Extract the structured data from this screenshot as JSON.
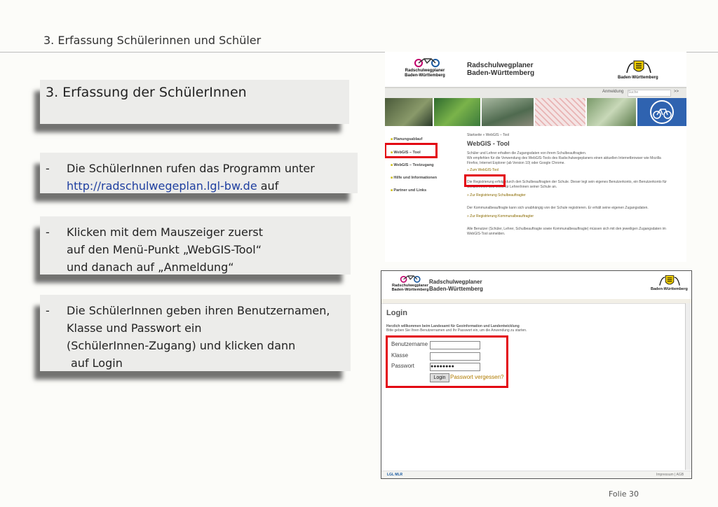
{
  "slide": {
    "header": "3. Erfassung Schülerinnen und Schüler",
    "folio": "Folie 30"
  },
  "boxes": {
    "title": "3. Erfassung der SchülerInnen",
    "dash": "-",
    "b1_line1": "Die SchülerInnen rufen das Programm unter",
    "b1_link": "http://radschulwegeplan.lgl-bw.de",
    "b1_after": "auf",
    "b2_line1": "Klicken mit dem Mauszeiger zuerst",
    "b2_line2": "auf den Menü-Punkt „WebGIS-Tool“",
    "b2_line3": "und danach auf „Anmeldung“",
    "b3_line1": "Die SchülerInnen geben ihren Benutzernamen,",
    "b3_line2": "Klasse und Passwort ein",
    "b3_line3": "(SchülerInnen-Zugang) und klicken dann",
    "b3_line4": "auf Login"
  },
  "shot1": {
    "logo_text_1": "Radschulwegplaner",
    "logo_text_2": "Baden-Württemberg",
    "site_title_1": "Radschulwegplaner",
    "site_title_2": "Baden-Württemberg",
    "state_name": "Baden-Württemberg",
    "anmeldung": "Anmeldung",
    "search_placeholder": "Suche",
    "go": ">>",
    "nav": [
      "Planungsablauf",
      "WebGIS – Tool",
      "WebGIS – Testzugang",
      "Hilfe und Informationen",
      "Partner und Links"
    ],
    "breadcrumb": "Startseite » WebGIS – Tool",
    "heading": "WebGIS - Tool",
    "p1": "Schüler und Lehrer erhalten die Zugangsdaten von ihrem Schulbeauftragten.",
    "p1b": "Wir empfehlen für die Verwendung des WebGIS-Tools des Radschulwegeplaners einen aktuellen Internetbrowser wie Mozilla",
    "p1c": "Firefox, Internet Explorer (ab Version 10) oder Google Chrome.",
    "link_tool": "» Zum WebGIS-Tool",
    "p2": "Die Registrierung erfolgt durch den Schulbeauftragten der Schule. Dieser legt sein eigenes Benutzerkonto, ein Benutzerkonto für",
    "p2b": "SchülerInnen und eines für LehrerInnen seiner Schule an.",
    "link_reg_school": "» Zur Registrierung Schulbeauftragter",
    "p3": "Der Kommunalbeauftragte kann sich unabhängig von der Schule registrieren. Er erhält seine eigenen Zugangsdaten.",
    "link_reg_comm": "» Zur Registrierung Kommunalbeauftragter",
    "p4": "Alle Benutzer (Schüler, Lehrer, Schulbeauftragte sowie Kommunalbeauftragte) müssen sich mit den jeweiligen Zugangsdaten im",
    "p4b": "WebGIS-Tool anmelden."
  },
  "shot2": {
    "logo_text_1": "Radschulwegplaner",
    "logo_text_2": "Baden-Württemberg",
    "site_title_1": "Radschulwegplaner",
    "site_title_2": "Baden-Württemberg",
    "state_name": "Baden-Württemberg",
    "login_heading": "Login",
    "note1": "Herzlich willkommen beim Landesamt für Geoinformation und Landentwicklung",
    "note2": "Bitte geben Sie Ihren Benutzernamen und Ihr Passwort ein, um die Anwendung zu starten.",
    "label_user": "Benutzername",
    "label_class": "Klasse",
    "label_pass": "Passwort",
    "value_user": "",
    "value_class": "",
    "value_pass": "●●●●●●●●",
    "login_button": "Login",
    "forgot": "Passwort vergessen?",
    "footer_logos": "LGL  MLR",
    "footer_links": "Impressum | AGB"
  },
  "colors": {
    "highlight_red": "#e30613",
    "link_blue": "#1f3fa0",
    "box_bg": "#ececea"
  }
}
